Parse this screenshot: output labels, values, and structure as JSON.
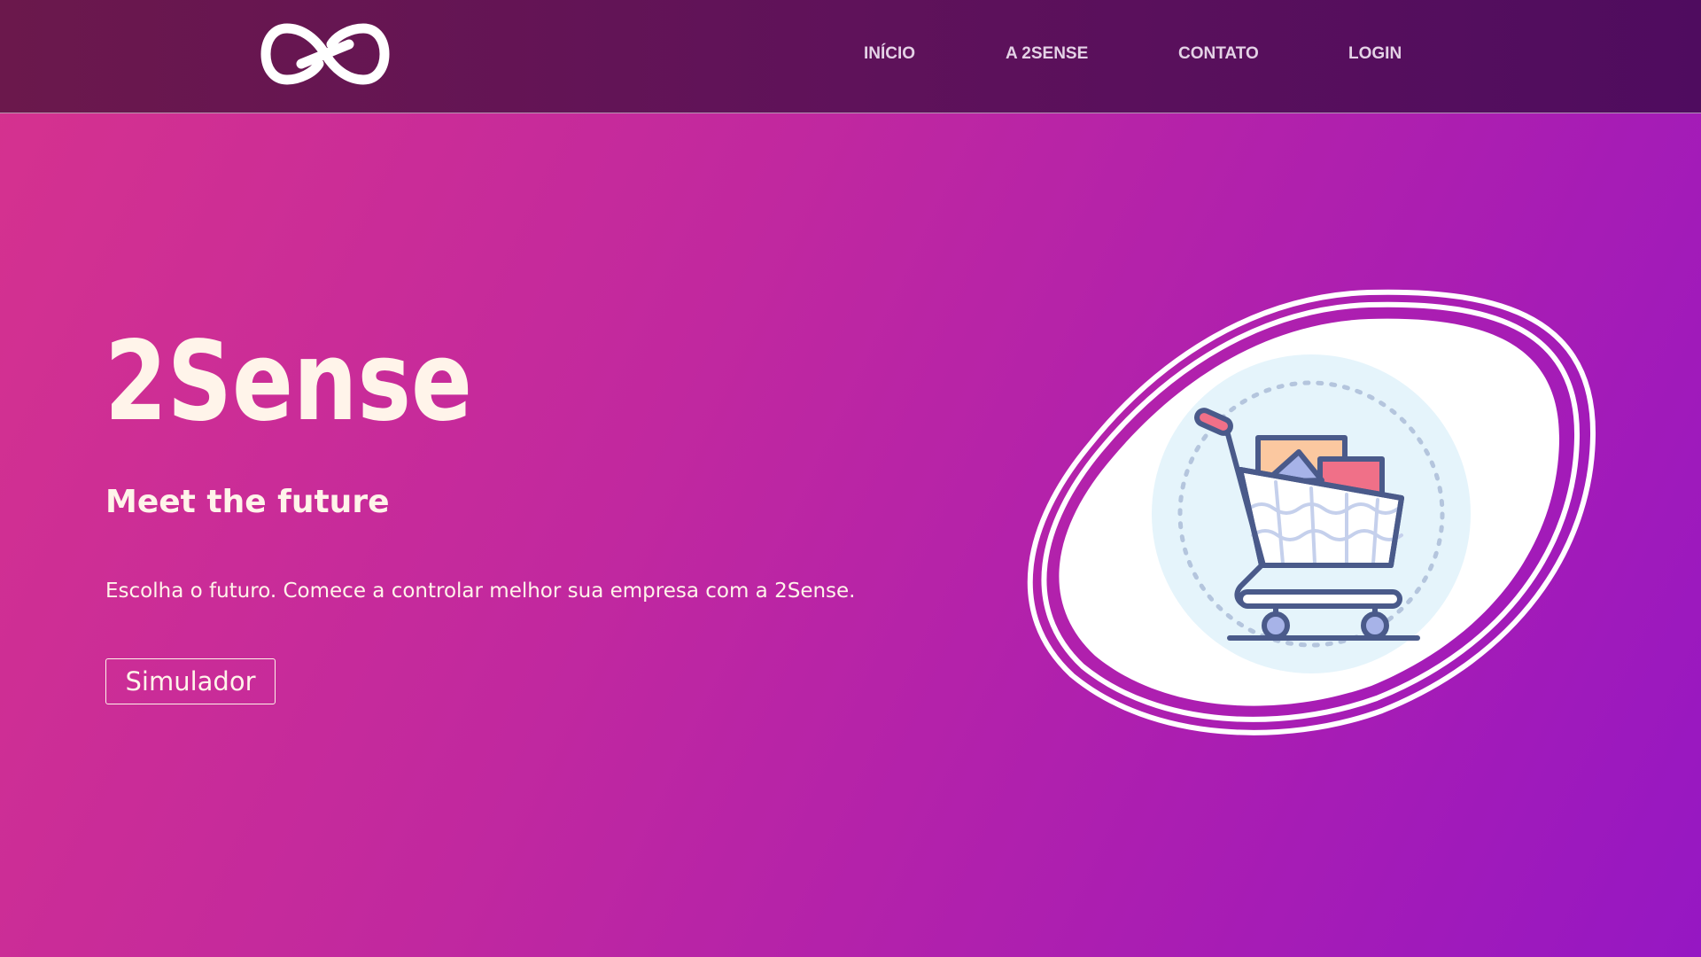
{
  "nav": {
    "logo_icon": "infinity-icon",
    "items": [
      {
        "label": "INÍCIO"
      },
      {
        "label": "A 2SENSE"
      },
      {
        "label": "CONTATO"
      },
      {
        "label": "LOGIN"
      }
    ]
  },
  "hero": {
    "title": "2Sense",
    "tagline": "Meet the future",
    "description": "Escolha o futuro. Comece a controlar melhor sua empresa com a 2Sense.",
    "button_label": "Simulador",
    "illustration_icon": "shopping-cart-icon"
  },
  "colors": {
    "header_bg": "#5f125a",
    "gradient_start": "#d6328e",
    "gradient_end": "#9617c3",
    "text_light": "#fff4ea",
    "nav_text": "#e4d2e6",
    "cart_stroke": "#4a5a8a",
    "cart_accent": "#f07088"
  }
}
